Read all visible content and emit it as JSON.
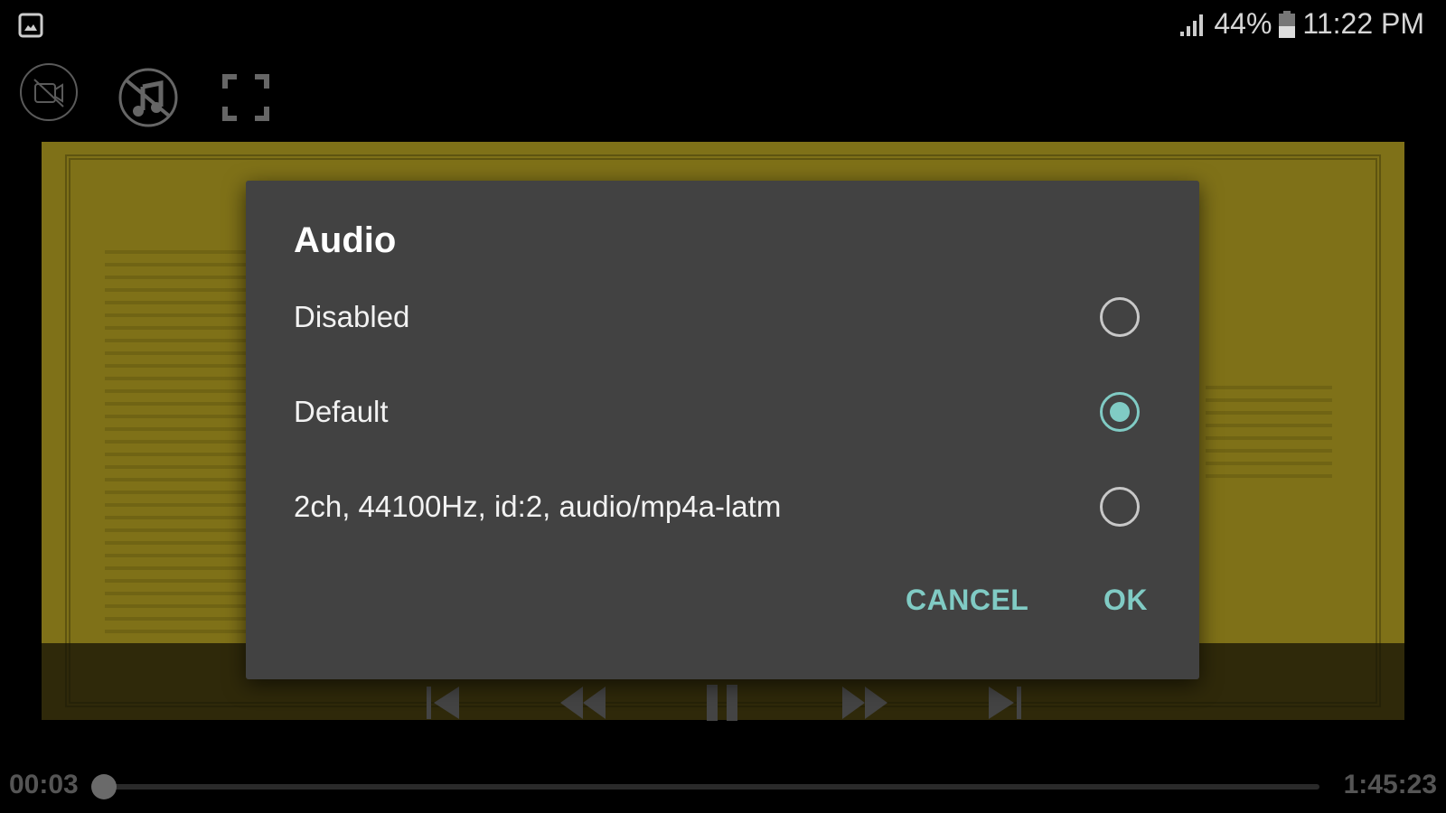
{
  "status_bar": {
    "notification_icon": "image-icon",
    "signal_icon": "signal-icon",
    "battery": "44%",
    "battery_icon": "battery-icon",
    "time": "11:22 PM"
  },
  "top_toolbar": {
    "icons": [
      "video-off-icon",
      "music-off-icon",
      "fullscreen-icon"
    ]
  },
  "dialog": {
    "title": "Audio",
    "options": [
      {
        "label": "Disabled",
        "selected": false
      },
      {
        "label": "Default",
        "selected": true
      },
      {
        "label": "2ch, 44100Hz, id:2, audio/mp4a-latm",
        "selected": false
      }
    ],
    "cancel_label": "CANCEL",
    "ok_label": "OK",
    "accent_color": "#80cbc4"
  },
  "player": {
    "controls": [
      "skip-previous-icon",
      "rewind-icon",
      "pause-icon",
      "fast-forward-icon",
      "skip-next-icon"
    ],
    "elapsed": "00:03",
    "duration": "1:45:23",
    "progress_fraction": 0.0005
  }
}
